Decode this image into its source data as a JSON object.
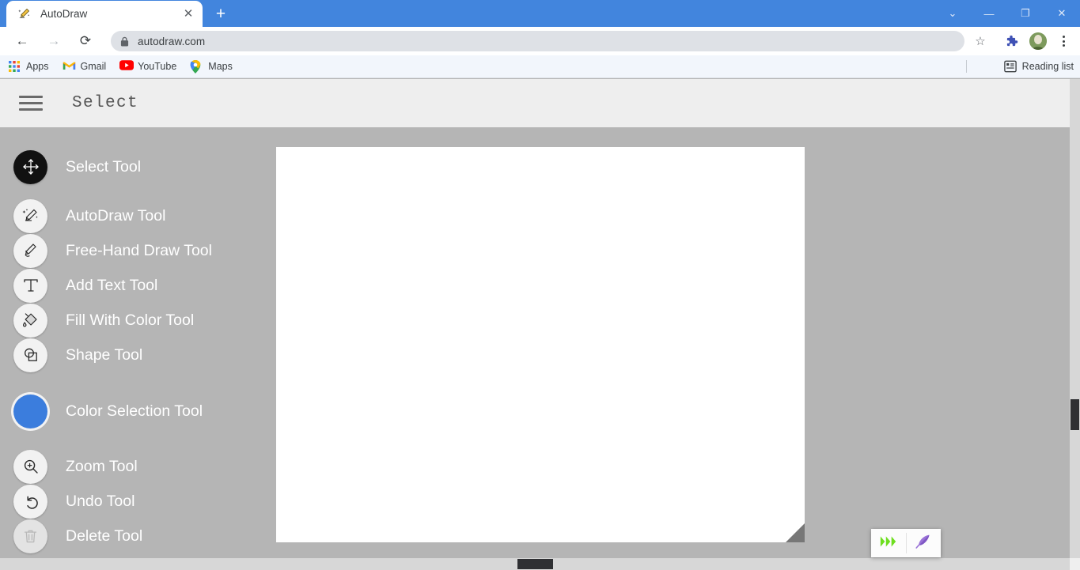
{
  "browser": {
    "tab": {
      "title": "AutoDraw",
      "favicon": "autodraw-pencil-icon",
      "close_label": "✕"
    },
    "new_tab_label": "+",
    "window_controls": [
      {
        "name": "tab-search-button",
        "glyph": "⌄"
      },
      {
        "name": "minimize-button",
        "glyph": "—"
      },
      {
        "name": "maximize-button",
        "glyph": "❐"
      },
      {
        "name": "close-window-button",
        "glyph": "✕"
      }
    ],
    "nav": {
      "back_glyph": "←",
      "forward_glyph": "→",
      "reload_glyph": "⟳"
    },
    "omnibox": {
      "url": "autodraw.com",
      "lock_icon": "lock-icon",
      "star_glyph": "☆"
    },
    "extensions": {
      "puzzle_icon": "extensions-puzzle-icon",
      "profile_icon": "profile-avatar",
      "menu_icon": "chrome-menu-icon"
    },
    "bookmarks": [
      {
        "label": "Apps",
        "icon": "apps-grid-icon"
      },
      {
        "label": "Gmail",
        "icon": "gmail-icon"
      },
      {
        "label": "YouTube",
        "icon": "youtube-icon"
      },
      {
        "label": "Maps",
        "icon": "maps-pin-icon"
      }
    ],
    "reading_list": {
      "label": "Reading list",
      "icon": "reading-list-icon"
    }
  },
  "app": {
    "menu_icon": "hamburger-menu-icon",
    "title": "Select",
    "tools": [
      {
        "label": "Select Tool",
        "icon": "move-arrows-icon",
        "state": "active"
      },
      {
        "label": "AutoDraw Tool",
        "icon": "magic-pencil-icon",
        "state": "idle",
        "gap": true
      },
      {
        "label": "Free-Hand Draw Tool",
        "icon": "pencil-icon",
        "state": "idle"
      },
      {
        "label": "Add Text Tool",
        "icon": "text-t-icon",
        "state": "idle"
      },
      {
        "label": "Fill With Color Tool",
        "icon": "paint-bucket-icon",
        "state": "idle"
      },
      {
        "label": "Shape Tool",
        "icon": "shapes-icon",
        "state": "idle"
      },
      {
        "label": "Color Selection Tool",
        "icon": "color-swatch",
        "state": "swatch",
        "color": "#3b7ddd",
        "gap": true
      },
      {
        "label": "Zoom Tool",
        "icon": "magnifier-plus-icon",
        "state": "idle",
        "gap": true
      },
      {
        "label": "Undo Tool",
        "icon": "undo-arrow-icon",
        "state": "idle"
      },
      {
        "label": "Delete Tool",
        "icon": "trash-can-icon",
        "state": "idle"
      }
    ],
    "canvas": {
      "name": "drawing-canvas",
      "background": "#ffffff"
    },
    "grammarly": {
      "chevron_icon": "grammarly-chevron-icon",
      "chevron_color": "#6ede1f",
      "quill_icon": "grammarly-quill-icon",
      "quill_color": "#9a72d8"
    }
  },
  "colors": {
    "tab_strip": "#4285dd",
    "app_background": "#b5b5b5",
    "app_header": "#eeeeee",
    "bookmarks_bar": "#f2f6fc",
    "accent_blue": "#3b7ddd",
    "scrollbar_thumb": "#2f3033"
  }
}
